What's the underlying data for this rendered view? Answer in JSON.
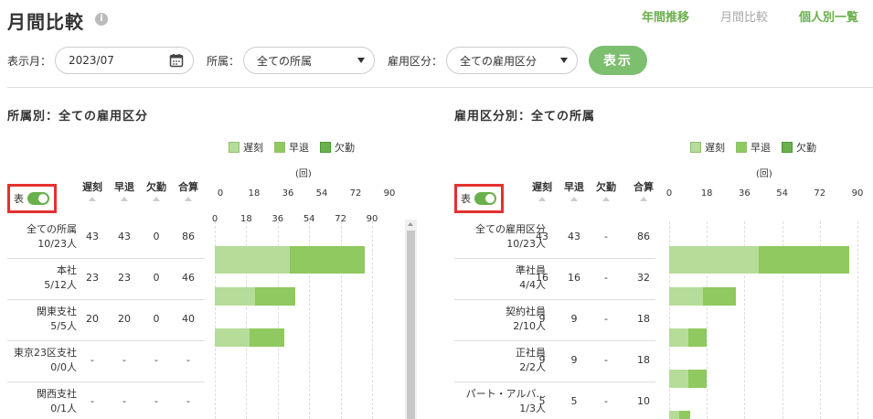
{
  "header": {
    "title": "月間比較",
    "nav": [
      {
        "label": "年間推移",
        "state": "link"
      },
      {
        "label": "月間比較",
        "state": "current"
      },
      {
        "label": "個人別一覧",
        "state": "link"
      }
    ]
  },
  "filters": {
    "month_label": "表示月：",
    "month_value": "2023/07",
    "dept_label": "所属：",
    "dept_value": "全ての所属",
    "emp_label": "雇用区分：",
    "emp_value": "全ての雇用区分",
    "show_button": "表示"
  },
  "colors": {
    "late": "#b5dc99",
    "early": "#8fc95f",
    "absent": "#6ab04c",
    "accent": "#6ab04c"
  },
  "legend": [
    {
      "label": "遅刻",
      "color": "#b5dc99"
    },
    {
      "label": "早退",
      "color": "#8fc95f"
    },
    {
      "label": "欠勤",
      "color": "#6ab04c"
    }
  ],
  "unit_label": "(回)",
  "toggle_label": "表",
  "columns": [
    "遅刻",
    "早退",
    "欠勤",
    "合算"
  ],
  "axis_ticks": [
    "0",
    "18",
    "36",
    "54",
    "72",
    "90"
  ],
  "left_panel": {
    "title": "所属別：全ての雇用区分",
    "rows": [
      {
        "name": "全ての所属",
        "count": "10/23人",
        "late": "43",
        "early": "43",
        "absent": "0",
        "total": "86",
        "v": [
          43,
          43,
          0
        ]
      },
      {
        "name": "本社",
        "count": "5/12人",
        "late": "23",
        "early": "23",
        "absent": "0",
        "total": "46",
        "v": [
          23,
          23,
          0
        ]
      },
      {
        "name": "関東支社",
        "count": "5/5人",
        "late": "20",
        "early": "20",
        "absent": "0",
        "total": "40",
        "v": [
          20,
          20,
          0
        ]
      },
      {
        "name": "東京23区支社",
        "count": "0/0人",
        "late": "-",
        "early": "-",
        "absent": "-",
        "total": "-",
        "v": [
          0,
          0,
          0
        ]
      },
      {
        "name": "関西支社",
        "count": "0/1人",
        "late": "-",
        "early": "-",
        "absent": "-",
        "total": "-",
        "v": [
          0,
          0,
          0
        ]
      }
    ]
  },
  "right_panel": {
    "title": "雇用区分別：全ての所属",
    "rows": [
      {
        "name": "全ての雇用区分",
        "count": "10/23人",
        "late": "43",
        "early": "43",
        "absent": "-",
        "total": "86",
        "v": [
          43,
          43,
          0
        ]
      },
      {
        "name": "準社員",
        "count": "4/4人",
        "late": "16",
        "early": "16",
        "absent": "-",
        "total": "32",
        "v": [
          16,
          16,
          0
        ]
      },
      {
        "name": "契約社員",
        "count": "2/10人",
        "late": "9",
        "early": "9",
        "absent": "-",
        "total": "18",
        "v": [
          9,
          9,
          0
        ]
      },
      {
        "name": "正社員",
        "count": "2/2人",
        "late": "9",
        "early": "9",
        "absent": "-",
        "total": "18",
        "v": [
          9,
          9,
          0
        ]
      },
      {
        "name": "パート・アルバ...",
        "count": "1/3人",
        "late": "5",
        "early": "5",
        "absent": "-",
        "total": "10",
        "v": [
          5,
          5,
          0
        ]
      }
    ]
  },
  "chart_data": [
    {
      "type": "bar",
      "title": "所属別：全ての雇用区分",
      "categories": [
        "全ての所属",
        "本社",
        "関東支社",
        "東京23区支社",
        "関西支社"
      ],
      "series": [
        {
          "name": "遅刻",
          "values": [
            43,
            23,
            20,
            0,
            0
          ]
        },
        {
          "name": "早退",
          "values": [
            43,
            23,
            20,
            0,
            0
          ]
        },
        {
          "name": "欠勤",
          "values": [
            0,
            0,
            0,
            0,
            0
          ]
        }
      ],
      "xlim": [
        0,
        90
      ],
      "stacked": true,
      "orientation": "horizontal"
    },
    {
      "type": "bar",
      "title": "雇用区分別：全ての所属",
      "categories": [
        "全ての雇用区分",
        "準社員",
        "契約社員",
        "正社員",
        "パート・アルバ..."
      ],
      "series": [
        {
          "name": "遅刻",
          "values": [
            43,
            16,
            9,
            9,
            5
          ]
        },
        {
          "name": "早退",
          "values": [
            43,
            16,
            9,
            9,
            5
          ]
        },
        {
          "name": "欠勤",
          "values": [
            0,
            0,
            0,
            0,
            0
          ]
        }
      ],
      "xlim": [
        0,
        90
      ],
      "stacked": true,
      "orientation": "horizontal"
    }
  ]
}
